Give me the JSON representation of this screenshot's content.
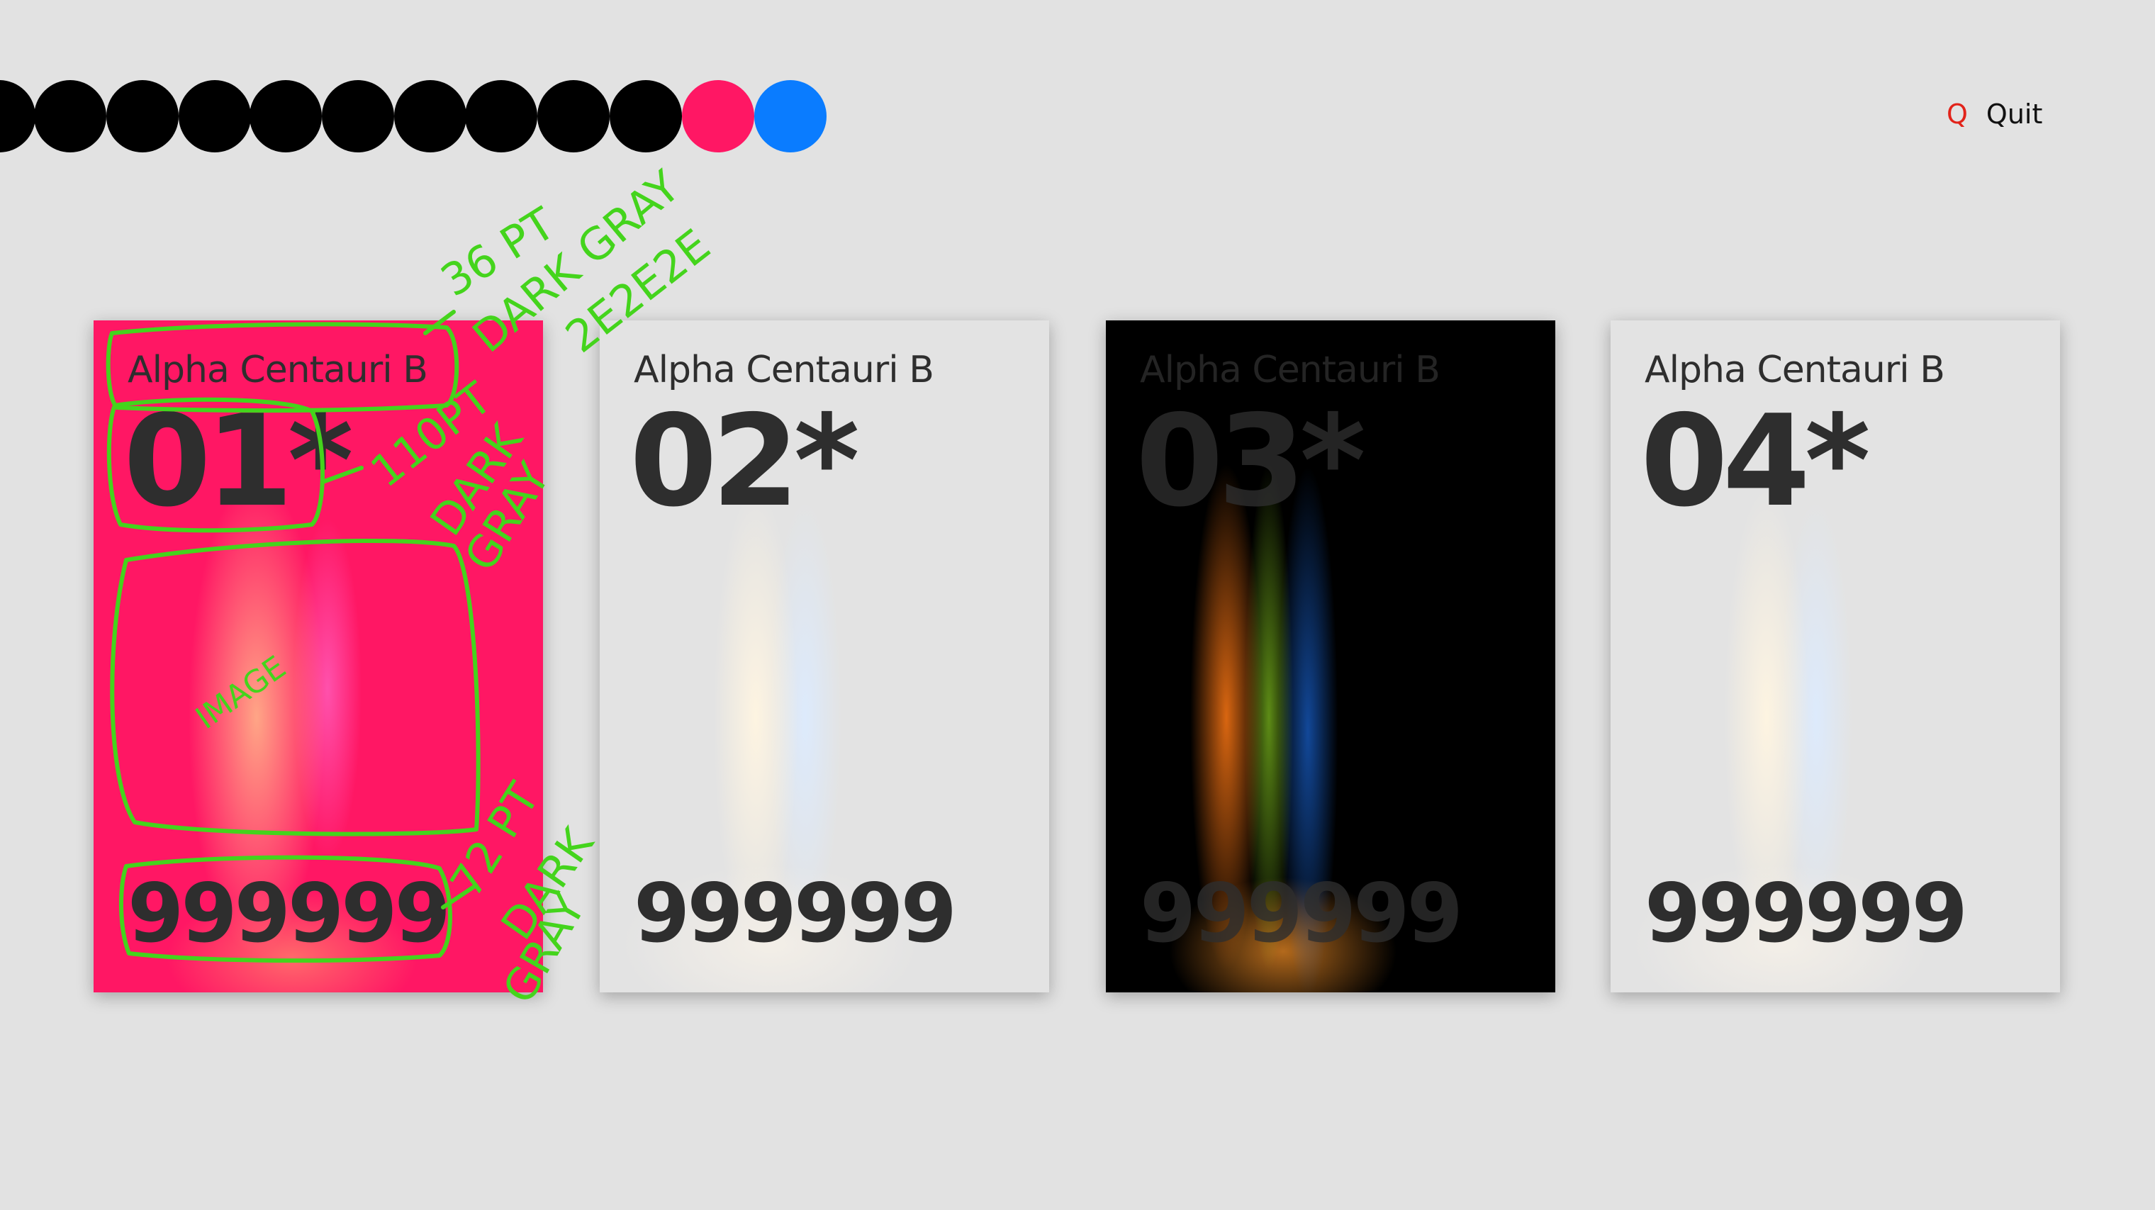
{
  "progress": {
    "dots": [
      {
        "color": "black"
      },
      {
        "color": "black"
      },
      {
        "color": "black"
      },
      {
        "color": "black"
      },
      {
        "color": "black"
      },
      {
        "color": "black"
      },
      {
        "color": "black"
      },
      {
        "color": "black"
      },
      {
        "color": "black"
      },
      {
        "color": "black"
      },
      {
        "color": "pink"
      },
      {
        "color": "blue"
      }
    ],
    "colors": {
      "black": "#000000",
      "pink": "#ff1764",
      "blue": "#0a7cff"
    }
  },
  "quit": {
    "key": "Q",
    "label": "Quit",
    "key_color": "#e2231a"
  },
  "cards": [
    {
      "name": "Alpha Centauri B",
      "number": "01*",
      "count": "999999",
      "image": "pink-light-leak",
      "background": "#ff1764"
    },
    {
      "name": "Alpha Centauri B",
      "number": "02*",
      "count": "999999",
      "image": "white-light-leak",
      "background": "#e4e4e4"
    },
    {
      "name": "Alpha Centauri B",
      "number": "03*",
      "count": "999999",
      "image": "rainbow-light-leak",
      "background": "#000000"
    },
    {
      "name": "Alpha Centauri B",
      "number": "04*",
      "count": "999999",
      "image": "white-light-leak",
      "background": "#e4e4e4"
    }
  ],
  "annotations": {
    "color": "#44d41c",
    "title_note": [
      "36 PT",
      "DARK GRAY",
      "2E2E2E"
    ],
    "number_note": [
      "110PT",
      "DARK",
      "GRAY"
    ],
    "image_note": "IMAGE",
    "count_note": [
      "72 PT",
      "DARK",
      "GRAY"
    ]
  }
}
